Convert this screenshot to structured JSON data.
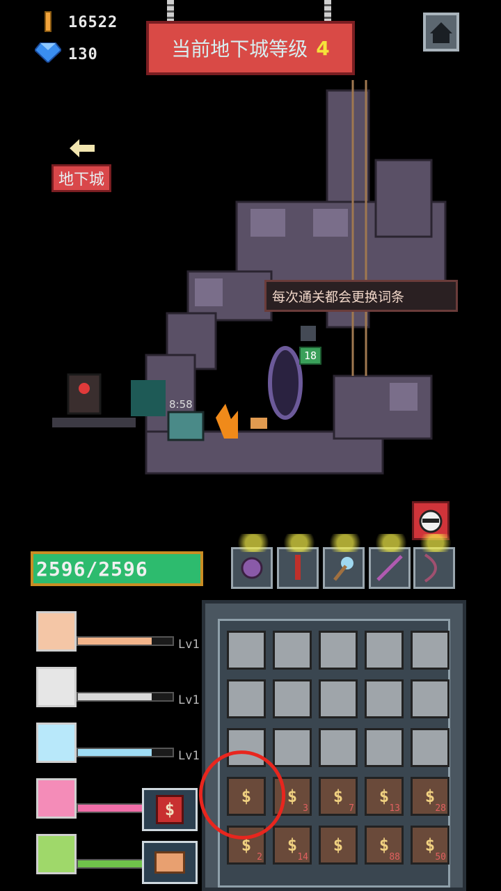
{
  "resources": {
    "gold": "16522",
    "gems": "130"
  },
  "banner": {
    "title": "当前地下城等级",
    "level": "4"
  },
  "nav": {
    "dungeon_label": "地下城"
  },
  "tooltip": {
    "text": "每次通关都会更换词条"
  },
  "world": {
    "chest_timer": "8:58",
    "enemy_level": "18"
  },
  "player": {
    "hp": "2596/2596"
  },
  "stats": [
    {
      "name": "shield",
      "level": "Lv1",
      "fill": 0.78,
      "color": "#f2b48a",
      "icon_bg": "#f4c6a6"
    },
    {
      "name": "sword",
      "level": "Lv1",
      "fill": 0.78,
      "color": "#d8d8d8",
      "icon_bg": "#e6e6e6"
    },
    {
      "name": "staff",
      "level": "Lv1",
      "fill": 0.78,
      "color": "#9fdcf4",
      "icon_bg": "#b8e8fa"
    },
    {
      "name": "spear",
      "level": "",
      "fill": 1.0,
      "color": "#f06ea8",
      "icon_bg": "#f48cb8"
    },
    {
      "name": "bow",
      "level": "",
      "fill": 1.0,
      "color": "#6fc24a",
      "icon_bg": "#9fd86a"
    }
  ],
  "inventory_counts": [
    "",
    "3",
    "7",
    "13",
    "28",
    "2",
    "14",
    "",
    "88",
    "50"
  ]
}
